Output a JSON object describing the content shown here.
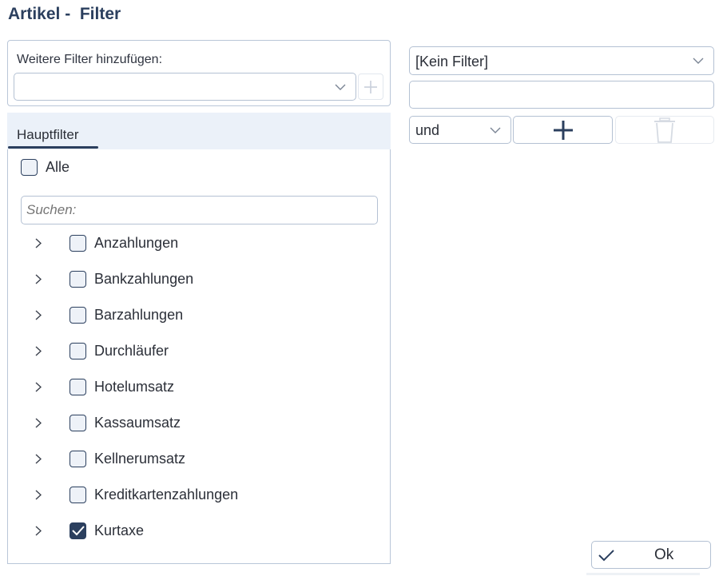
{
  "title": "Artikel -  Filter",
  "add_filter": {
    "label": "Weitere Filter hinzufügen:",
    "selected_value": "",
    "add_icon": "plus-icon"
  },
  "tabs": [
    {
      "label": "Hauptfilter",
      "active": true
    }
  ],
  "select_all": {
    "label": "Alle",
    "checked": false
  },
  "search": {
    "placeholder": "Suchen:",
    "value": ""
  },
  "tree_items": [
    {
      "label": "Anzahlungen",
      "checked": false
    },
    {
      "label": "Bankzahlungen",
      "checked": false
    },
    {
      "label": "Barzahlungen",
      "checked": false
    },
    {
      "label": "Durchläufer",
      "checked": false
    },
    {
      "label": "Hotelumsatz",
      "checked": false
    },
    {
      "label": "Kassaumsatz",
      "checked": false
    },
    {
      "label": "Kellnerumsatz",
      "checked": false
    },
    {
      "label": "Kreditkartenzahlungen",
      "checked": false
    },
    {
      "label": "Kurtaxe",
      "checked": true
    }
  ],
  "right_panel": {
    "filter_select": {
      "value": "[Kein Filter]"
    },
    "value_input": {
      "value": ""
    },
    "operator_select": {
      "value": "und"
    },
    "add_icon": "plus-icon",
    "delete_icon": "trash-icon"
  },
  "ok_button": {
    "label": "Ok",
    "icon": "checkmark-icon"
  },
  "colors": {
    "accent": "#2b3f5e",
    "border": "#b4c1d3",
    "tab_background": "#ebf1f9"
  }
}
